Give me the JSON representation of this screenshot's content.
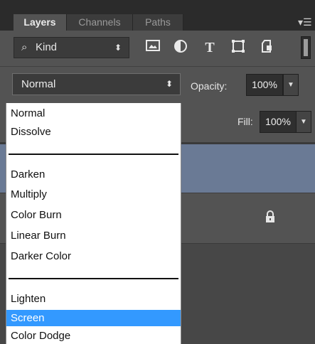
{
  "tabs": [
    {
      "label": "Layers",
      "active": true
    },
    {
      "label": "Channels",
      "active": false
    },
    {
      "label": "Paths",
      "active": false
    }
  ],
  "panel_menu_icon": "panel-menu-icon",
  "filter": {
    "kind_label": "Kind",
    "icons": [
      "pixel-filter-icon",
      "adjustment-filter-icon",
      "type-filter-icon",
      "shape-filter-icon",
      "smart-object-filter-icon"
    ]
  },
  "blend": {
    "mode": "Normal",
    "opacity_label": "Opacity:",
    "opacity_value": "100%"
  },
  "fill": {
    "label": "Fill:",
    "value": "100%"
  },
  "menu": {
    "groups": [
      [
        "Normal",
        "Dissolve"
      ],
      [
        "Darken",
        "Multiply",
        "Color Burn",
        "Linear Burn",
        "Darker Color"
      ],
      [
        "Lighten",
        "Screen",
        "Color Dodge"
      ]
    ],
    "highlighted": "Screen"
  },
  "colors": {
    "panel_bg": "#535353",
    "selected_layer": "#6a7a95",
    "menu_highlight": "#3399ff"
  }
}
